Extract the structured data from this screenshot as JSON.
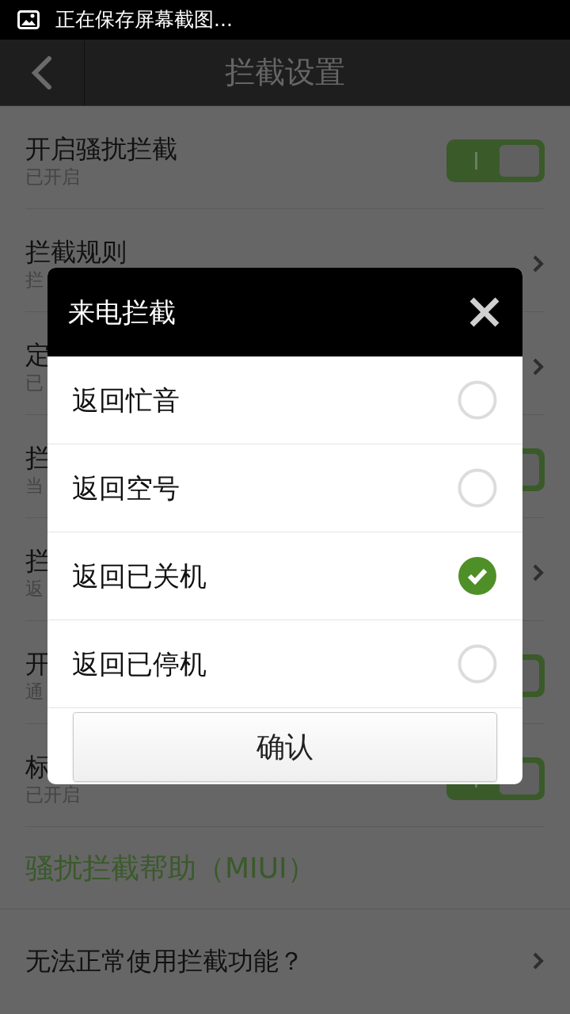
{
  "status_bar": {
    "notification": "正在保存屏幕截图..."
  },
  "header": {
    "title": "拦截设置"
  },
  "settings": [
    {
      "kind": "switch",
      "title": "开启骚扰拦截",
      "subtitle": "已开启",
      "on": true
    },
    {
      "kind": "link",
      "title": "拦截规则",
      "subtitle": "拦"
    },
    {
      "kind": "link",
      "title": "定",
      "subtitle": "已"
    },
    {
      "kind": "switch",
      "title": "拦",
      "subtitle": "当",
      "on": true
    },
    {
      "kind": "link",
      "title": "拦",
      "subtitle": "返"
    },
    {
      "kind": "switch",
      "title": "开",
      "subtitle": "通",
      "on": true
    },
    {
      "kind": "switch",
      "title": "标",
      "subtitle": "已开启",
      "on": true
    }
  ],
  "help_section": {
    "title": "骚扰拦截帮助（MIUI）",
    "items": [
      {
        "title": "无法正常使用拦截功能？"
      }
    ]
  },
  "dialog": {
    "title": "来电拦截",
    "options": [
      {
        "label": "返回忙音",
        "selected": false
      },
      {
        "label": "返回空号",
        "selected": false
      },
      {
        "label": "返回已关机",
        "selected": true
      },
      {
        "label": "返回已停机",
        "selected": false
      }
    ],
    "confirm": "确认"
  }
}
